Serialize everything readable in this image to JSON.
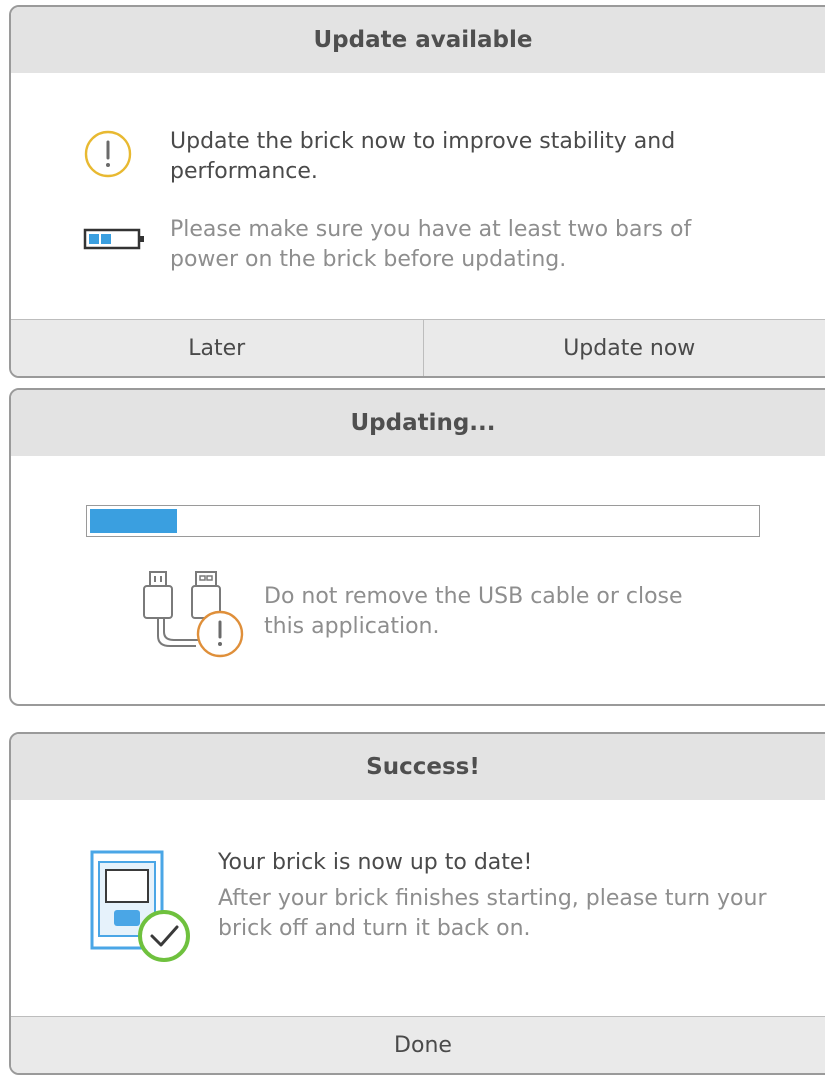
{
  "dialogs": {
    "update": {
      "title": "Update available",
      "message": "Update the brick now to improve stability and performance.",
      "battery_note": "Please make sure you have at least two bars of power on the brick before updating.",
      "later_label": "Later",
      "update_now_label": "Update now"
    },
    "updating": {
      "title": "Updating...",
      "progress": 0.13,
      "warning": "Do not remove the USB cable or close this application."
    },
    "success": {
      "title": "Success!",
      "headline": "Your brick is now up to date!",
      "instruction": "After your brick finishes starting, please turn your brick off and turn it back on.",
      "done_label": "Done"
    }
  },
  "colors": {
    "warning_yellow": "#e8b931",
    "warning_orange": "#df8f3a",
    "progress_blue": "#3a9fe0",
    "success_green": "#6fc13e",
    "brick_blue": "#4aa6e6"
  },
  "icons": {
    "update": "exclamation-circle-icon",
    "battery": "battery-icon",
    "usb": "usb-cable-warning-icon",
    "brick": "brick-check-icon"
  }
}
